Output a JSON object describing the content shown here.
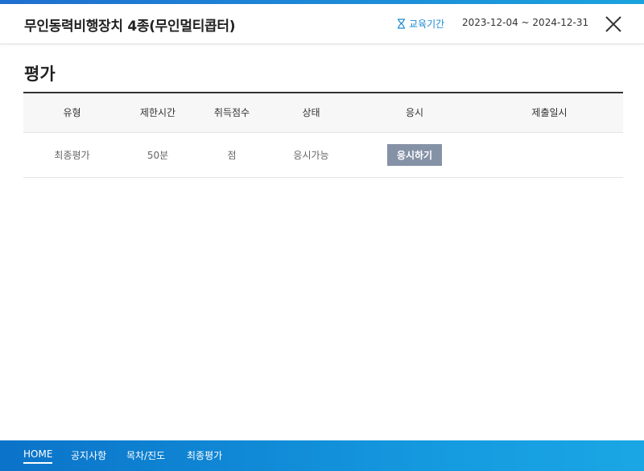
{
  "header": {
    "course_title": "무인동력비행장치 4종(무인멀티콥터)",
    "period_label": "교육기간",
    "period_dates": "2023-12-04 ~ 2024-12-31",
    "close_icon": "close-icon"
  },
  "section": {
    "title": "평가"
  },
  "table": {
    "columns": [
      "유형",
      "제한시간",
      "취득점수",
      "상태",
      "응시",
      "제출일시"
    ],
    "rows": [
      {
        "type": "최종평가",
        "time_limit": "50분",
        "score": "점",
        "status": "응시가능",
        "action": "응시하기",
        "submitted": ""
      }
    ]
  },
  "bottom_nav": {
    "items": [
      "HOME",
      "공지사항",
      "목차/진도",
      "최종평가"
    ],
    "active": "HOME"
  },
  "colors": {
    "accent": "#1a8ad0",
    "nav_bg": "#0b73c9",
    "button_bg": "#8592a6"
  }
}
